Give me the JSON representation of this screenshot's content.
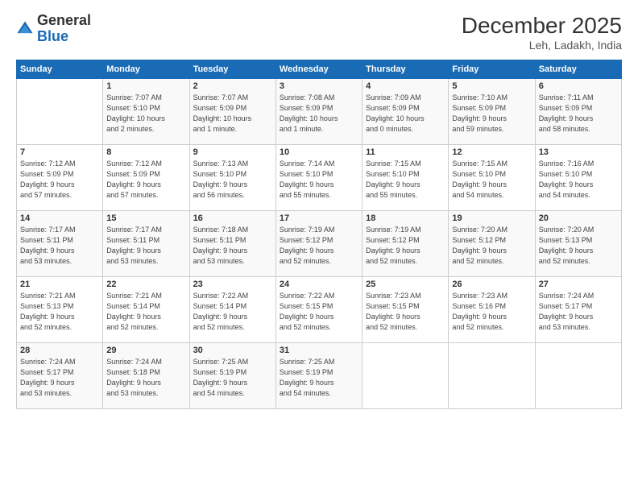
{
  "header": {
    "logo_general": "General",
    "logo_blue": "Blue",
    "month_title": "December 2025",
    "subtitle": "Leh, Ladakh, India"
  },
  "days_of_week": [
    "Sunday",
    "Monday",
    "Tuesday",
    "Wednesday",
    "Thursday",
    "Friday",
    "Saturday"
  ],
  "weeks": [
    [
      {
        "day": "",
        "info": ""
      },
      {
        "day": "1",
        "info": "Sunrise: 7:07 AM\nSunset: 5:10 PM\nDaylight: 10 hours\nand 2 minutes."
      },
      {
        "day": "2",
        "info": "Sunrise: 7:07 AM\nSunset: 5:09 PM\nDaylight: 10 hours\nand 1 minute."
      },
      {
        "day": "3",
        "info": "Sunrise: 7:08 AM\nSunset: 5:09 PM\nDaylight: 10 hours\nand 1 minute."
      },
      {
        "day": "4",
        "info": "Sunrise: 7:09 AM\nSunset: 5:09 PM\nDaylight: 10 hours\nand 0 minutes."
      },
      {
        "day": "5",
        "info": "Sunrise: 7:10 AM\nSunset: 5:09 PM\nDaylight: 9 hours\nand 59 minutes."
      },
      {
        "day": "6",
        "info": "Sunrise: 7:11 AM\nSunset: 5:09 PM\nDaylight: 9 hours\nand 58 minutes."
      }
    ],
    [
      {
        "day": "7",
        "info": "Sunrise: 7:12 AM\nSunset: 5:09 PM\nDaylight: 9 hours\nand 57 minutes."
      },
      {
        "day": "8",
        "info": "Sunrise: 7:12 AM\nSunset: 5:09 PM\nDaylight: 9 hours\nand 57 minutes."
      },
      {
        "day": "9",
        "info": "Sunrise: 7:13 AM\nSunset: 5:10 PM\nDaylight: 9 hours\nand 56 minutes."
      },
      {
        "day": "10",
        "info": "Sunrise: 7:14 AM\nSunset: 5:10 PM\nDaylight: 9 hours\nand 55 minutes."
      },
      {
        "day": "11",
        "info": "Sunrise: 7:15 AM\nSunset: 5:10 PM\nDaylight: 9 hours\nand 55 minutes."
      },
      {
        "day": "12",
        "info": "Sunrise: 7:15 AM\nSunset: 5:10 PM\nDaylight: 9 hours\nand 54 minutes."
      },
      {
        "day": "13",
        "info": "Sunrise: 7:16 AM\nSunset: 5:10 PM\nDaylight: 9 hours\nand 54 minutes."
      }
    ],
    [
      {
        "day": "14",
        "info": "Sunrise: 7:17 AM\nSunset: 5:11 PM\nDaylight: 9 hours\nand 53 minutes."
      },
      {
        "day": "15",
        "info": "Sunrise: 7:17 AM\nSunset: 5:11 PM\nDaylight: 9 hours\nand 53 minutes."
      },
      {
        "day": "16",
        "info": "Sunrise: 7:18 AM\nSunset: 5:11 PM\nDaylight: 9 hours\nand 53 minutes."
      },
      {
        "day": "17",
        "info": "Sunrise: 7:19 AM\nSunset: 5:12 PM\nDaylight: 9 hours\nand 52 minutes."
      },
      {
        "day": "18",
        "info": "Sunrise: 7:19 AM\nSunset: 5:12 PM\nDaylight: 9 hours\nand 52 minutes."
      },
      {
        "day": "19",
        "info": "Sunrise: 7:20 AM\nSunset: 5:12 PM\nDaylight: 9 hours\nand 52 minutes."
      },
      {
        "day": "20",
        "info": "Sunrise: 7:20 AM\nSunset: 5:13 PM\nDaylight: 9 hours\nand 52 minutes."
      }
    ],
    [
      {
        "day": "21",
        "info": "Sunrise: 7:21 AM\nSunset: 5:13 PM\nDaylight: 9 hours\nand 52 minutes."
      },
      {
        "day": "22",
        "info": "Sunrise: 7:21 AM\nSunset: 5:14 PM\nDaylight: 9 hours\nand 52 minutes."
      },
      {
        "day": "23",
        "info": "Sunrise: 7:22 AM\nSunset: 5:14 PM\nDaylight: 9 hours\nand 52 minutes."
      },
      {
        "day": "24",
        "info": "Sunrise: 7:22 AM\nSunset: 5:15 PM\nDaylight: 9 hours\nand 52 minutes."
      },
      {
        "day": "25",
        "info": "Sunrise: 7:23 AM\nSunset: 5:15 PM\nDaylight: 9 hours\nand 52 minutes."
      },
      {
        "day": "26",
        "info": "Sunrise: 7:23 AM\nSunset: 5:16 PM\nDaylight: 9 hours\nand 52 minutes."
      },
      {
        "day": "27",
        "info": "Sunrise: 7:24 AM\nSunset: 5:17 PM\nDaylight: 9 hours\nand 53 minutes."
      }
    ],
    [
      {
        "day": "28",
        "info": "Sunrise: 7:24 AM\nSunset: 5:17 PM\nDaylight: 9 hours\nand 53 minutes."
      },
      {
        "day": "29",
        "info": "Sunrise: 7:24 AM\nSunset: 5:18 PM\nDaylight: 9 hours\nand 53 minutes."
      },
      {
        "day": "30",
        "info": "Sunrise: 7:25 AM\nSunset: 5:19 PM\nDaylight: 9 hours\nand 54 minutes."
      },
      {
        "day": "31",
        "info": "Sunrise: 7:25 AM\nSunset: 5:19 PM\nDaylight: 9 hours\nand 54 minutes."
      },
      {
        "day": "",
        "info": ""
      },
      {
        "day": "",
        "info": ""
      },
      {
        "day": "",
        "info": ""
      }
    ]
  ]
}
